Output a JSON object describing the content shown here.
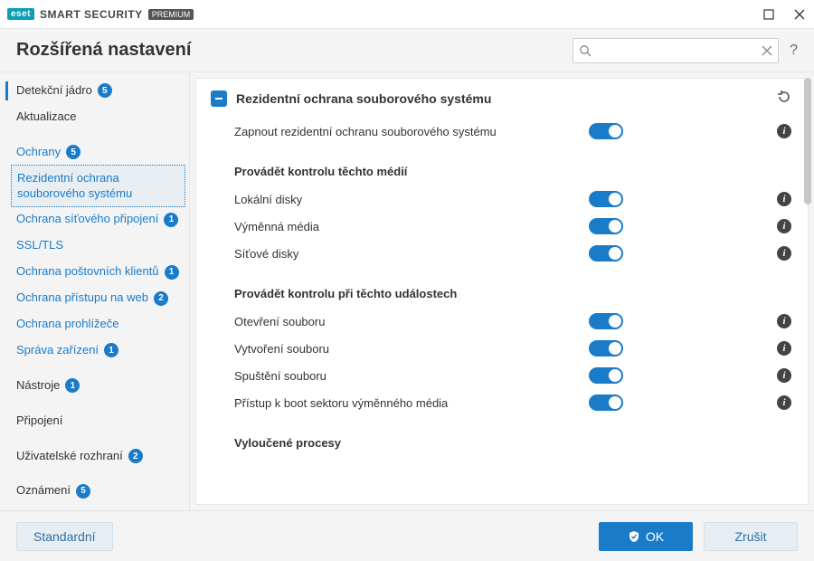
{
  "brand": {
    "eset": "eset",
    "smart": "SMART SECURITY",
    "premium": "PREMIUM"
  },
  "page_title": "Rozšířená nastavení",
  "search": {
    "placeholder": ""
  },
  "sidebar": {
    "items": [
      {
        "label": "Detekční jádro",
        "badge": "5",
        "kind": "top",
        "active_top": true
      },
      {
        "label": "Aktualizace",
        "kind": "top"
      },
      {
        "kind": "gap"
      },
      {
        "label": "Ochrany",
        "badge": "5",
        "kind": "top-link"
      },
      {
        "label": "Rezidentní ochrana souborového systému",
        "kind": "sub",
        "selected": true
      },
      {
        "label": "Ochrana síťového připojení",
        "badge": "1",
        "kind": "sub"
      },
      {
        "label": "SSL/TLS",
        "kind": "sub"
      },
      {
        "label": "Ochrana poštovních klientů",
        "badge": "1",
        "kind": "sub"
      },
      {
        "label": "Ochrana přístupu na web",
        "badge": "2",
        "kind": "sub"
      },
      {
        "label": "Ochrana prohlížeče",
        "kind": "sub"
      },
      {
        "label": "Správa zařízení",
        "badge": "1",
        "kind": "sub"
      },
      {
        "kind": "gap"
      },
      {
        "label": "Nástroje",
        "badge": "1",
        "kind": "top"
      },
      {
        "kind": "gap"
      },
      {
        "label": "Připojení",
        "kind": "top"
      },
      {
        "kind": "gap"
      },
      {
        "label": "Uživatelské rozhraní",
        "badge": "2",
        "kind": "top"
      },
      {
        "kind": "gap"
      },
      {
        "label": "Oznámení",
        "badge": "5",
        "kind": "top"
      }
    ]
  },
  "content": {
    "section_title": "Rezidentní ochrana souborového systému",
    "enable_row": {
      "label": "Zapnout rezidentní ochranu souborového systému",
      "on": true
    },
    "group_media": {
      "heading": "Provádět kontrolu těchto médií",
      "rows": [
        {
          "label": "Lokální disky",
          "on": true
        },
        {
          "label": "Výměnná média",
          "on": true
        },
        {
          "label": "Síťové disky",
          "on": true
        }
      ]
    },
    "group_events": {
      "heading": "Provádět kontrolu při těchto událostech",
      "rows": [
        {
          "label": "Otevření souboru",
          "on": true
        },
        {
          "label": "Vytvoření souboru",
          "on": true
        },
        {
          "label": "Spuštění souboru",
          "on": true
        },
        {
          "label": "Přístup k boot sektoru výměnného média",
          "on": true
        }
      ]
    },
    "group_excluded": {
      "heading": "Vyloučené procesy"
    }
  },
  "footer": {
    "default_label": "Standardní",
    "ok_label": "OK",
    "cancel_label": "Zrušit"
  },
  "colors": {
    "accent": "#1a7bc9"
  }
}
